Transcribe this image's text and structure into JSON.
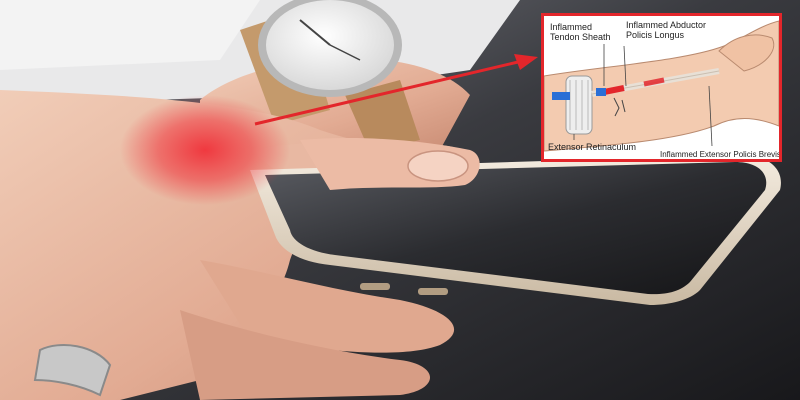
{
  "inset": {
    "labels": {
      "tendon_sheath": "Inflammed Tendon Sheath",
      "abductor": "Inflammed Abductor Policis Longus",
      "retinaculum": "Extensor Retinaculum",
      "brevis": "Inflammed Extensor Policis Brevis"
    }
  },
  "colors": {
    "pain_highlight": "#f0323a",
    "pointer_arrow": "#e3262b",
    "inset_border": "#e3262b"
  }
}
